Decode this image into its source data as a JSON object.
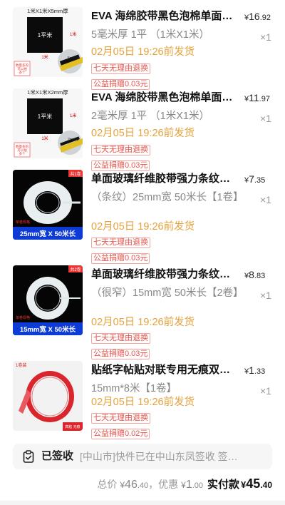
{
  "items": [
    {
      "title": "EVA 海绵胶带黑色泡棉单面…",
      "price_currency": "¥",
      "price_int": "16",
      "price_dec": ".92",
      "spec": "5毫米厚 1平 （1米X1米）",
      "qty": "×1",
      "ship": "02月05日 19:26前发货",
      "tag_return": "七天无理由退换",
      "tag_charity": "公益捐赠0.03元",
      "thumb_header": "1米X1米X5mm厚",
      "thumb_center": "1平米",
      "thumb_side": "1米",
      "thumb_circle": "5mm厚",
      "thumb_note": "数量多的\n可以拍\n多个"
    },
    {
      "title": "EVA 海绵胶带黑色泡棉单面…",
      "price_currency": "¥",
      "price_int": "11",
      "price_dec": ".97",
      "spec": "2毫米厚 1平 （1米X1米）",
      "qty": "×1",
      "ship": "02月05日 19:26前发货",
      "tag_return": "七天无理由退换",
      "tag_charity": "公益捐赠0.03元",
      "thumb_header": "1米X1米X2mm厚",
      "thumb_center": "1平米",
      "thumb_side": "1米",
      "thumb_circle": "2mm厚",
      "thumb_note": "数量多的\n可以拍\n多个"
    },
    {
      "title": "单面玻璃纤维胶带强力条纹工…",
      "price_currency": "¥",
      "price_int": "7",
      "price_dec": ".35",
      "spec": "（条纹）25mm宽 50米长【1卷】",
      "qty": "×1",
      "ship": "02月05日 19:26前发货",
      "tag_return": "七天无理由退换",
      "tag_charity": "公益捐赠0.03元",
      "thumb_corner": "共1卷",
      "thumb_small": "单卷规格",
      "thumb_bottom": "25mm宽 X 50米长"
    },
    {
      "title": "单面玻璃纤维胶带强力条纹工…",
      "price_currency": "¥",
      "price_int": "8",
      "price_dec": ".83",
      "spec": "（很窄）15mm宽 50米长【2卷】",
      "qty": "×1",
      "ship": "02月05日 19:26前发货",
      "tag_return": "七天无理由退换",
      "tag_charity": "公益捐赠0.03元",
      "thumb_corner": "共2卷",
      "thumb_small": "单卷规格",
      "thumb_bottom": "15mm宽 X 50米长"
    },
    {
      "title": "贴纸字帖贴对联专用无痕双面胶",
      "price_currency": "¥",
      "price_int": "1",
      "price_dec": ".33",
      "spec": "15mm*8米【1卷】",
      "qty": "×1",
      "ship": "02月05日 19:26前发货",
      "tag_return": "七天无理由退换",
      "tag_charity": "公益捐赠0.02元",
      "thumb_corner": "1卷装",
      "thumb_bottom": "高粘 无痕"
    }
  ],
  "status": {
    "label": "已签收",
    "text": "[中山市]快件已在中山东凤签收 签…",
    "icon": "clipboard-check-icon"
  },
  "totals": {
    "total_label": "总价",
    "total_currency": "¥",
    "total_int": "46",
    "total_dec": ".40",
    "sep": "，",
    "discount_label": "优惠",
    "discount_currency": "¥",
    "discount_int": "1",
    "discount_dec": ".00",
    "paid_label": "实付款",
    "paid_currency": "¥",
    "paid_int": "45",
    "paid_dec": ".40"
  },
  "colors": {
    "ship": "#e6a23c",
    "tag": "#e5544b",
    "tape_red": "#d9252b"
  }
}
